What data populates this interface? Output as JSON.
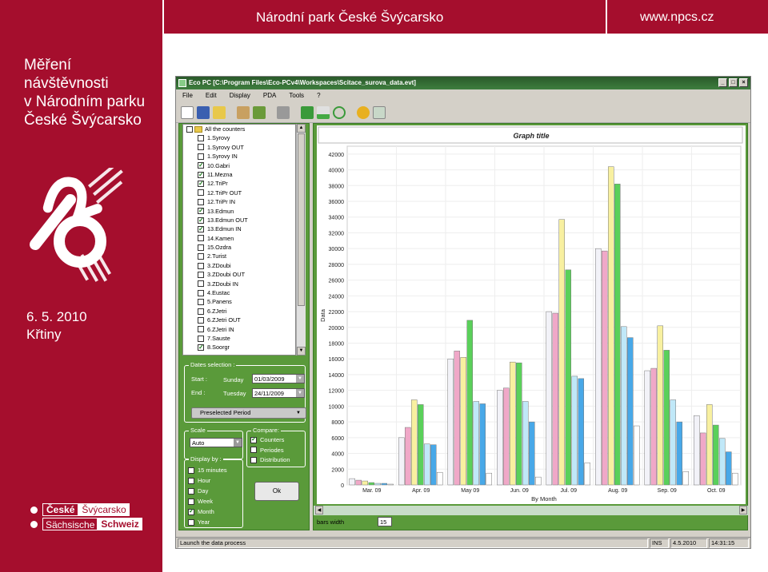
{
  "header": {
    "title": "Národní park České Švýcarsko",
    "url": "www.npcs.cz"
  },
  "sidebar": {
    "title_lines": [
      "Měření",
      "návštěvnosti",
      "v Národním parku",
      "České Švýcarsko"
    ],
    "date": "6. 5. 2010",
    "place": "Křtiny",
    "brand": {
      "row1_a": "České",
      "row1_b": "Švýcarsko",
      "row2_a": "Sächsische",
      "row2_b": "Schweiz"
    }
  },
  "app": {
    "title": "Eco PC [C:\\Program Files\\Eco-PCv4\\Workspaces\\Scitace_surova_data.evt]",
    "menu": [
      "File",
      "Edit",
      "Display",
      "PDA",
      "Tools",
      "?"
    ],
    "tree": {
      "root": "All the counters",
      "items": [
        {
          "label": "1.Syrovy",
          "checked": false
        },
        {
          "label": "1.Syrovy OUT",
          "checked": false
        },
        {
          "label": "1.Syrovy IN",
          "checked": false
        },
        {
          "label": "10.Gabri",
          "checked": true
        },
        {
          "label": "11.Mezna",
          "checked": true
        },
        {
          "label": "12.TriPr",
          "checked": true
        },
        {
          "label": "12.TriPr OUT",
          "checked": false
        },
        {
          "label": "12.TriPr IN",
          "checked": false
        },
        {
          "label": "13.Edmun",
          "checked": true
        },
        {
          "label": "13.Edmun OUT",
          "checked": true
        },
        {
          "label": "13.Edmun IN",
          "checked": true
        },
        {
          "label": "14.Kamen",
          "checked": false
        },
        {
          "label": "15.Ozdra",
          "checked": false
        },
        {
          "label": "2.Turist",
          "checked": false
        },
        {
          "label": "3.ZDoubi",
          "checked": false
        },
        {
          "label": "3.ZDoubi OUT",
          "checked": false
        },
        {
          "label": "3.ZDoubi IN",
          "checked": false
        },
        {
          "label": "4.Eustac",
          "checked": false
        },
        {
          "label": "5.Panens",
          "checked": false
        },
        {
          "label": "6.ZJetri",
          "checked": false
        },
        {
          "label": "6.ZJetri OUT",
          "checked": false
        },
        {
          "label": "6.ZJetri IN",
          "checked": false
        },
        {
          "label": "7.Sauste",
          "checked": false
        },
        {
          "label": "8.Soorgr",
          "checked": true
        }
      ]
    },
    "dates": {
      "legend": "Dates selection :",
      "start_label": "Start :",
      "start_day": "Sunday",
      "start_date": "01/03/2009",
      "end_label": "End :",
      "end_day": "Tuesday",
      "end_date": "24/11/2009",
      "preselected": "Preselected Period"
    },
    "scale": {
      "legend": "Scale",
      "value": "Auto"
    },
    "compare": {
      "legend": "Compare:",
      "options": [
        {
          "label": "Counters",
          "checked": true
        },
        {
          "label": "Periodes",
          "checked": false
        },
        {
          "label": "Distribution",
          "checked": false
        }
      ]
    },
    "display_by": {
      "legend": "Display by :",
      "options": [
        {
          "label": "15 minutes",
          "checked": false
        },
        {
          "label": "Hour",
          "checked": false
        },
        {
          "label": "Day",
          "checked": false
        },
        {
          "label": "Week",
          "checked": false
        },
        {
          "label": "Month",
          "checked": true
        },
        {
          "label": "Year",
          "checked": false
        }
      ]
    },
    "ok_label": "Ok",
    "bars_width_label": "bars width",
    "bars_width_value": "15",
    "status": {
      "text": "Launch the data process",
      "ins": "INS",
      "date": "4.5.2010",
      "time": "14:31:15"
    }
  },
  "colors": {
    "brand_red": "#a50e2d",
    "panel_green": "#5a9a3a"
  },
  "chart_data": {
    "type": "bar",
    "title": "Graph title",
    "xlabel": "By Month",
    "ylabel": "Data",
    "ylim": [
      0,
      43000
    ],
    "yticks": [
      0,
      2000,
      4000,
      6000,
      8000,
      10000,
      12000,
      14000,
      16000,
      18000,
      20000,
      22000,
      24000,
      26000,
      28000,
      30000,
      32000,
      34000,
      36000,
      38000,
      40000,
      42000
    ],
    "categories": [
      "Mar. 09",
      "Apr. 09",
      "May 09",
      "Jun. 09",
      "Jul. 09",
      "Aug. 09",
      "Sep. 09",
      "Oct. 09"
    ],
    "grid": true,
    "series": [
      {
        "color": "#f2f2f8",
        "values": [
          800,
          6000,
          16000,
          12000,
          22000,
          30000,
          14500,
          8800
        ]
      },
      {
        "color": "#f0a8c8",
        "values": [
          600,
          7300,
          17000,
          12300,
          21800,
          29700,
          14800,
          6600
        ]
      },
      {
        "color": "#f8f0a0",
        "values": [
          500,
          10800,
          16200,
          15600,
          33700,
          40400,
          20200,
          10200
        ]
      },
      {
        "color": "#5ad05a",
        "values": [
          300,
          10200,
          20900,
          15500,
          27300,
          38200,
          17100,
          7600
        ]
      },
      {
        "color": "#c0e8f8",
        "values": [
          200,
          5200,
          10600,
          10600,
          13800,
          20100,
          10800,
          5900
        ]
      },
      {
        "color": "#48a8e8",
        "values": [
          200,
          5100,
          10300,
          8000,
          13500,
          18700,
          8000,
          4200
        ]
      },
      {
        "color": "#ffffff",
        "values": [
          100,
          1600,
          1500,
          1000,
          2800,
          7500,
          1700,
          1500
        ]
      }
    ]
  }
}
